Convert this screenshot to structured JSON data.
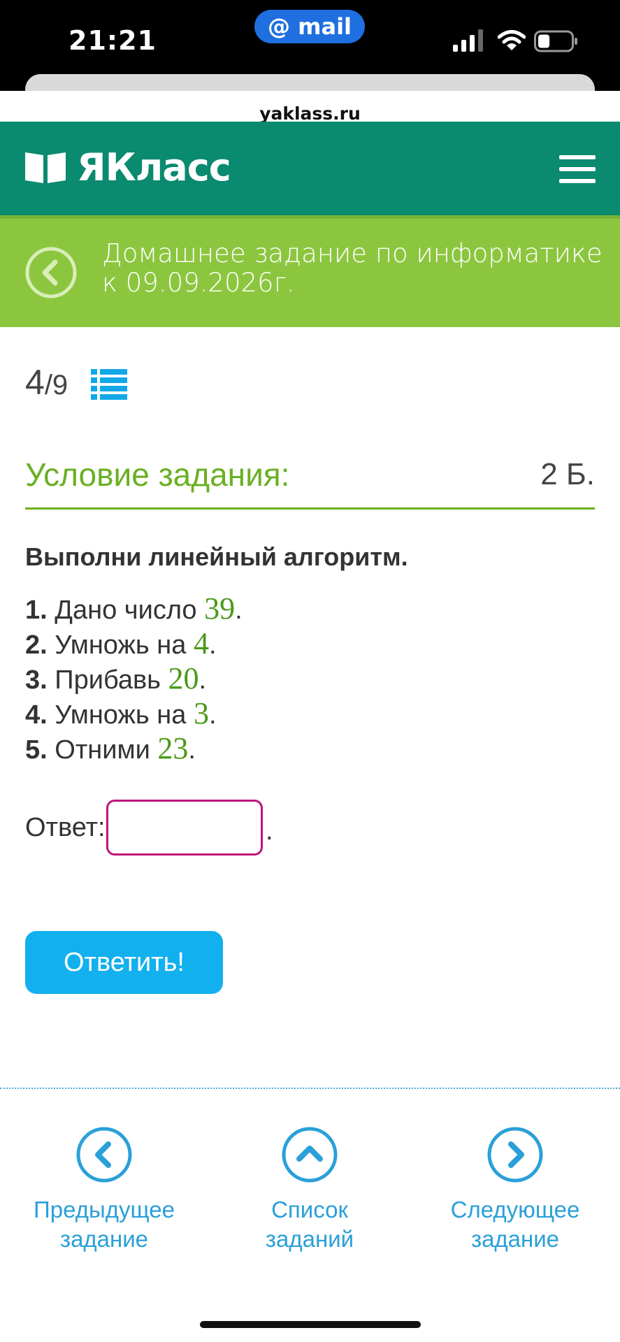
{
  "status_bar": {
    "time": "21:21",
    "mail_pill": "@ mail",
    "battery_level": 0.35
  },
  "browser": {
    "url": "yaklass.ru"
  },
  "header": {
    "logo_text": "ЯКласс",
    "brand_color": "#0a8a6f"
  },
  "banner": {
    "title": "Домашнее задание по информатике к 09.09.2026г.",
    "color": "#8cc63f"
  },
  "progress": {
    "current": "4",
    "total": "/9"
  },
  "condition": {
    "title": "Условие задания:",
    "points": "2 Б."
  },
  "task": {
    "heading": "Выполни линейный алгоритм.",
    "steps": [
      {
        "num": "1.",
        "text": "Дано число",
        "value": "39",
        "end": "."
      },
      {
        "num": "2.",
        "text": "Умножь на",
        "value": "4",
        "end": "."
      },
      {
        "num": "3.",
        "text": "Прибавь",
        "value": "20",
        "end": "."
      },
      {
        "num": "4.",
        "text": "Умножь на",
        "value": "3",
        "end": "."
      },
      {
        "num": "5.",
        "text": "Отними",
        "value": "23",
        "end": "."
      }
    ]
  },
  "answer": {
    "label": "Ответ:",
    "value": "",
    "suffix": "."
  },
  "submit": {
    "label": "Ответить!"
  },
  "nav": {
    "prev_line1": "Предыдущее",
    "prev_line2": "задание",
    "list_line1": "Список",
    "list_line2": "заданий",
    "next_line1": "Следующее",
    "next_line2": "задание"
  }
}
